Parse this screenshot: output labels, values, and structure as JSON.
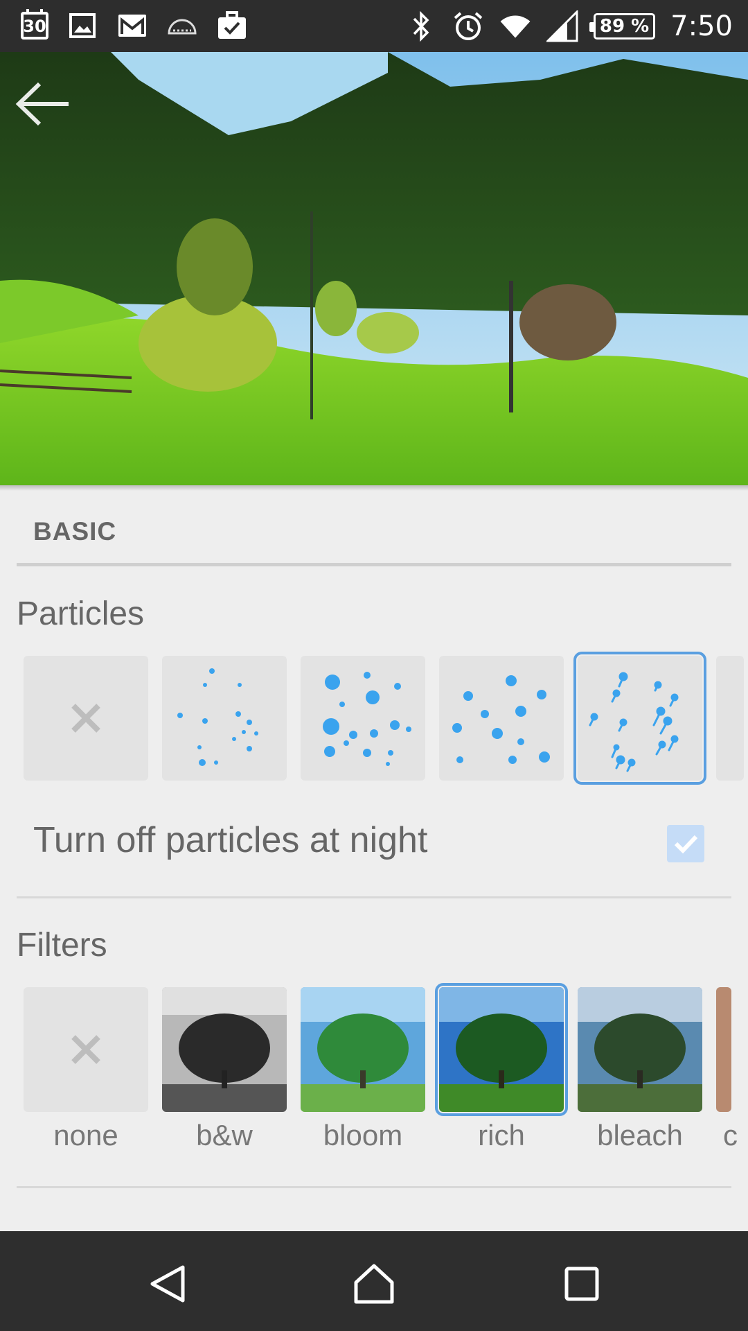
{
  "status_bar": {
    "calendar_day": "30",
    "battery": "89 %",
    "time": "7:50",
    "icons": [
      "calendar-icon",
      "gallery-icon",
      "gmail-icon",
      "cloud-icon",
      "work-briefcase-icon",
      "bluetooth-icon",
      "alarm-icon",
      "wifi-icon",
      "signal-icon",
      "battery-icon"
    ]
  },
  "header": {
    "back_icon": "arrow-back-icon"
  },
  "section": {
    "title": "BASIC"
  },
  "particles": {
    "heading": "Particles",
    "items": [
      {
        "name": "none",
        "icon": "close-icon"
      },
      {
        "name": "small-dots"
      },
      {
        "name": "large-dots"
      },
      {
        "name": "medium-dots"
      },
      {
        "name": "rain",
        "selected": true
      }
    ]
  },
  "night_toggle": {
    "label": "Turn off particles at night",
    "checked": true
  },
  "filters": {
    "heading": "Filters",
    "items": [
      {
        "label": "none",
        "icon": "close-icon"
      },
      {
        "label": "b&w"
      },
      {
        "label": "bloom"
      },
      {
        "label": "rich",
        "selected": true
      },
      {
        "label": "bleach"
      }
    ],
    "partial_next_label": "c"
  },
  "colors": {
    "accent": "#5a9fe0",
    "particle_blue": "#3aa3ee",
    "status_bar": "#2d2d2d",
    "nav_bar": "#2e2e2e"
  },
  "nav_bar": {
    "icons": [
      "back-triangle-icon",
      "home-icon",
      "recents-square-icon"
    ]
  }
}
